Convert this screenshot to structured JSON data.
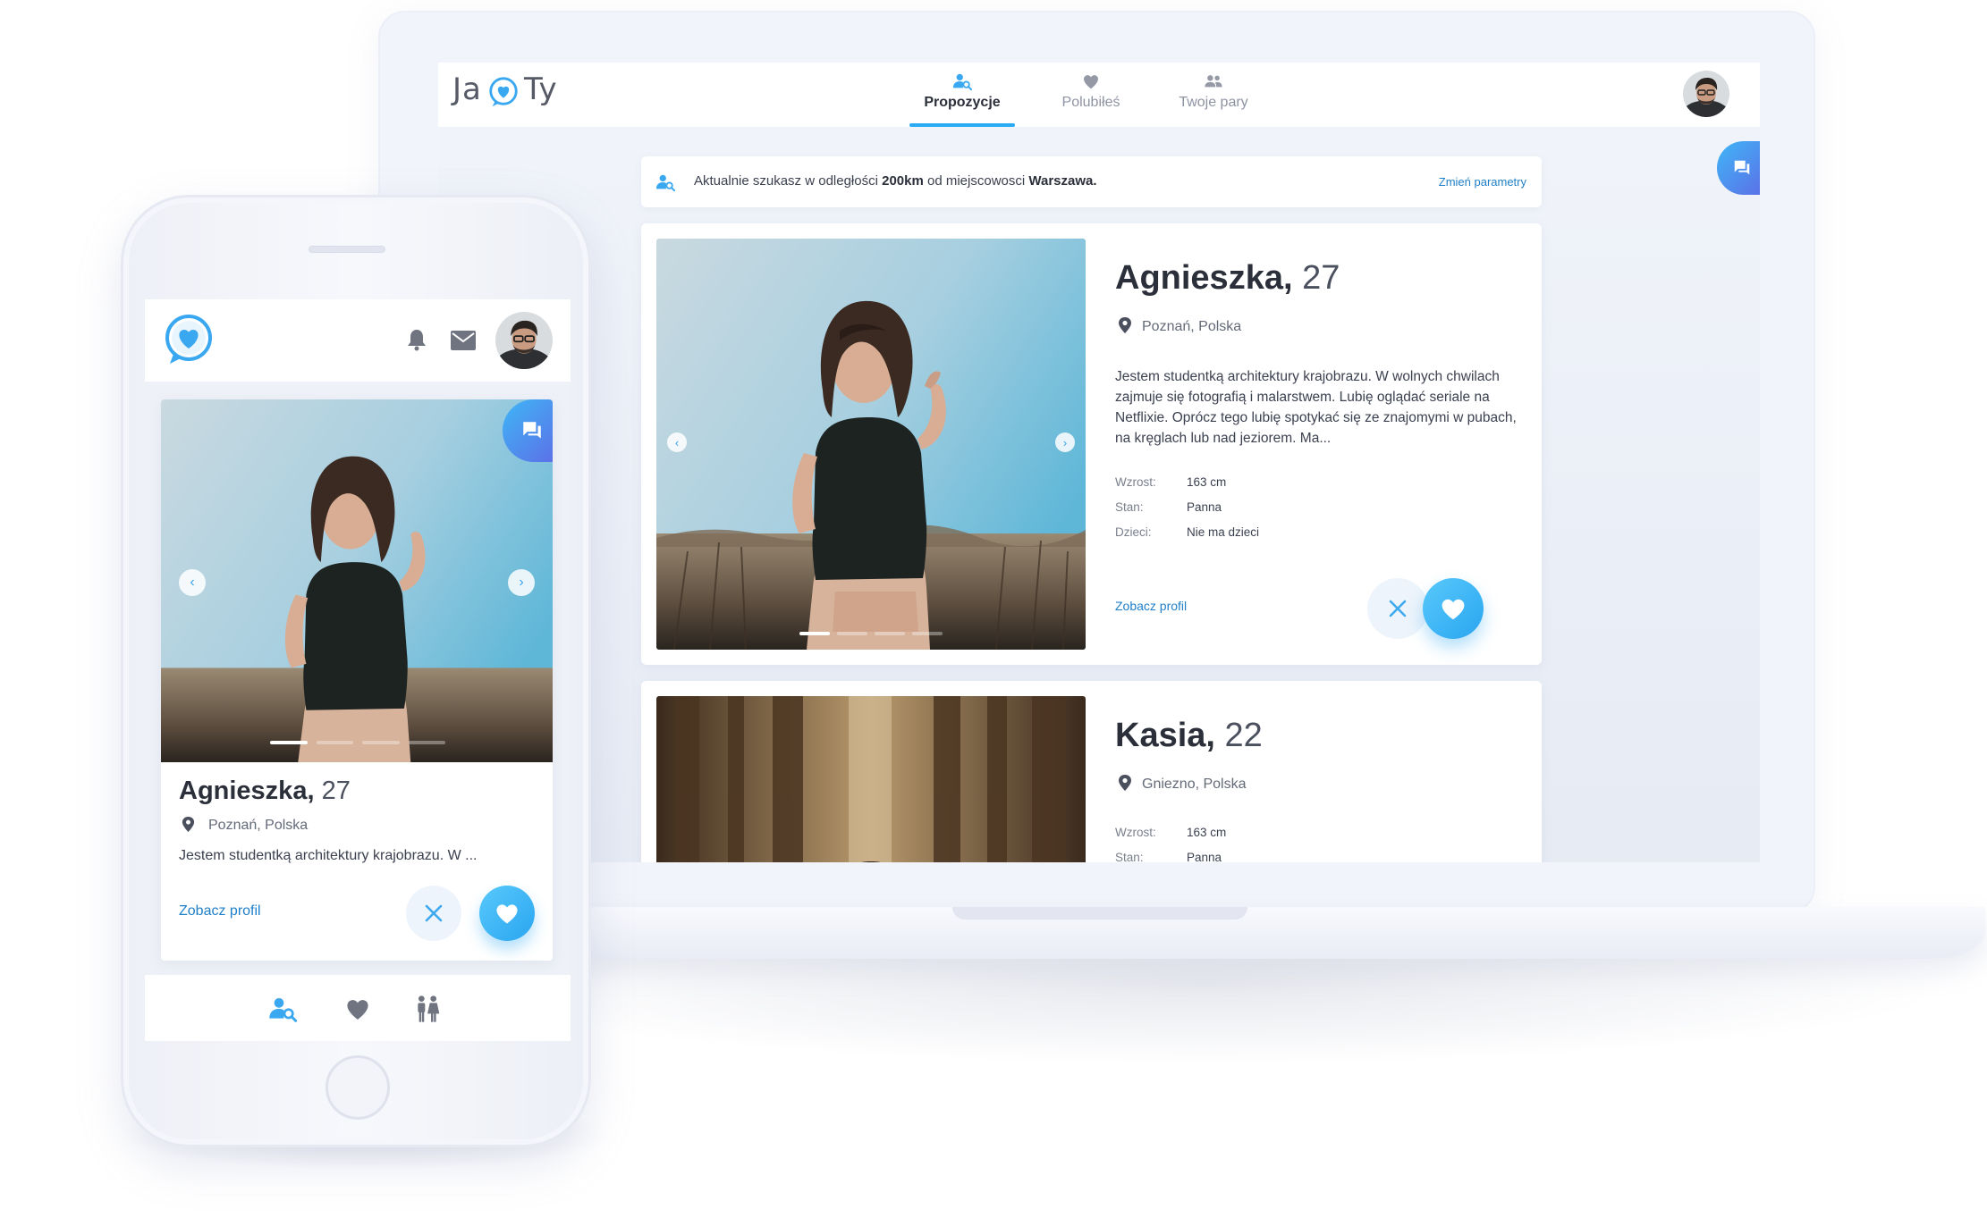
{
  "colors": {
    "accent": "#2aaaf2",
    "link": "#1f7fc8",
    "chat_gradient_start": "#3fb6f6",
    "chat_gradient_end": "#5b72e8",
    "text_dark": "#2b2f3a"
  },
  "laptop": {
    "logo": {
      "left": "Ja",
      "right": "Ty"
    },
    "nav": {
      "tabs": [
        {
          "label": "Propozycje",
          "icon": "user-search-icon",
          "active": true
        },
        {
          "label": "Polubiłeś",
          "icon": "heart-icon",
          "active": false
        },
        {
          "label": "Twoje pary",
          "icon": "users-icon",
          "active": false
        }
      ]
    },
    "search": {
      "prefix": "Aktualnie szukasz w odległości ",
      "distance": "200km",
      "middle": " od miejscowosci ",
      "city": "Warszawa.",
      "change_link": "Zmień parametry"
    },
    "profiles": [
      {
        "name": "Agnieszka,",
        "age": "27",
        "location": "Poznań, Polska",
        "bio": "Jestem studentką architektury krajobrazu. W wolnych chwilach zajmuje się fotografią i malarstwem. Lubię oglądać seriale na Netflixie. Oprócz tego lubię spotykać się ze znajomymi w pubach, na kręglach lub nad jeziorem. Ma...",
        "facts": [
          {
            "label": "Wzrost:",
            "value": "163 cm"
          },
          {
            "label": "Stan:",
            "value": "Panna"
          },
          {
            "label": "Dzieci:",
            "value": "Nie ma dzieci"
          }
        ],
        "profile_link": "Zobacz profil"
      },
      {
        "name": "Kasia,",
        "age": "22",
        "location": "Gniezno, Polska",
        "facts": [
          {
            "label": "Wzrost:",
            "value": "163 cm"
          },
          {
            "label": "Stan:",
            "value": "Panna"
          }
        ]
      }
    ]
  },
  "phone": {
    "profile": {
      "name": "Agnieszka,",
      "age": "27",
      "location": "Poznań, Polska",
      "bio": "Jestem studentką architektury krajobrazu. W ...",
      "profile_link": "Zobacz profil"
    },
    "tabbar": [
      {
        "icon": "user-search-icon",
        "active": true
      },
      {
        "icon": "heart-icon",
        "active": false
      },
      {
        "icon": "couple-icon",
        "active": false
      }
    ]
  }
}
